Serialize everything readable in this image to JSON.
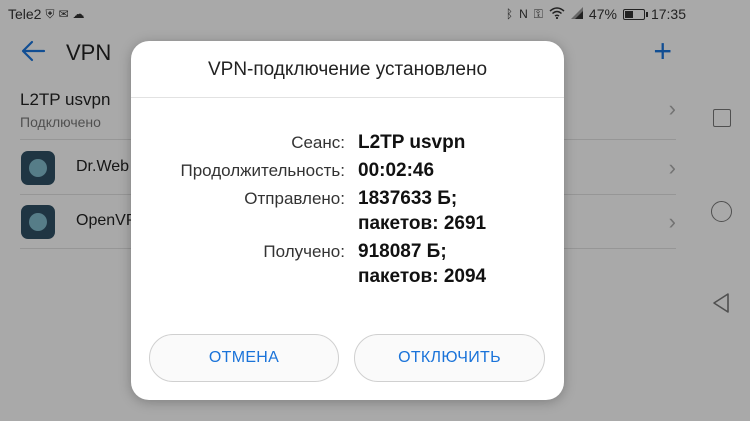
{
  "status_bar": {
    "carrier": "Tele2",
    "battery_percent": "47%",
    "battery_level": 0.47,
    "time": "17:35"
  },
  "app_bar": {
    "title": "VPN",
    "add_label": "+"
  },
  "vpn_list": {
    "profile": {
      "name": "L2TP usvpn",
      "status": "Подключено"
    },
    "apps": [
      {
        "name": "Dr.Web"
      },
      {
        "name": "OpenVPN"
      }
    ]
  },
  "dialog": {
    "title": "VPN-подключение установлено",
    "rows": [
      {
        "label": "Сеанс:",
        "value_lines": [
          "L2TP usvpn"
        ]
      },
      {
        "label": "Продолжительность:",
        "value_lines": [
          "00:02:46"
        ]
      },
      {
        "label": "Отправлено:",
        "value_lines": [
          "1837633 Б;",
          "пакетов: 2691"
        ]
      },
      {
        "label": "Получено:",
        "value_lines": [
          "918087 Б;",
          "пакетов: 2094"
        ]
      }
    ],
    "cancel_label": "ОТМЕНА",
    "disconnect_label": "ОТКЛЮЧИТЬ"
  },
  "colors": {
    "accent": "#1a73d9",
    "scrim": "rgba(0,0,0,0.32)"
  },
  "icons": [
    "sim-icon",
    "shield-icon",
    "mail-icon",
    "cloud-icon",
    "bluetooth-icon",
    "nfc-icon",
    "key-icon",
    "wifi-icon",
    "battery-icon",
    "back-arrow-icon",
    "add-icon",
    "chevron-right-icon",
    "drweb-app-icon",
    "openvpn-app-icon",
    "nav-recents-icon",
    "nav-home-icon",
    "nav-back-icon"
  ]
}
